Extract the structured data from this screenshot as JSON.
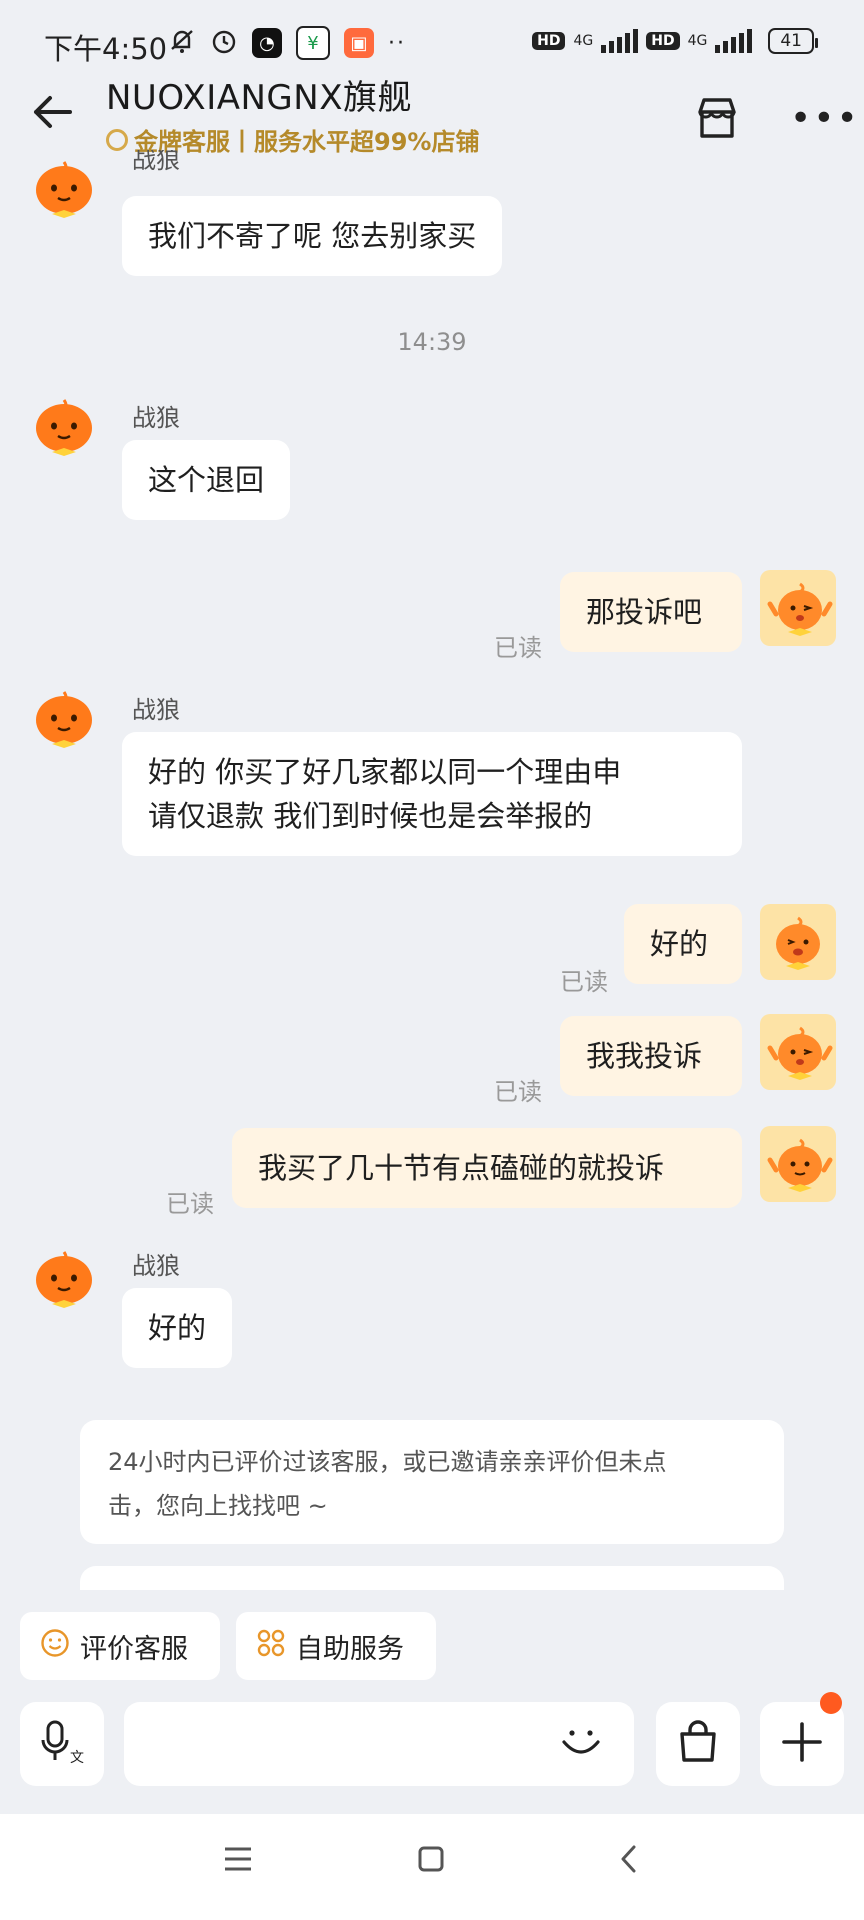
{
  "status_bar": {
    "time": "下午4:50",
    "network1": "HD",
    "network2": "HD",
    "signal_label": "4G",
    "battery": "41"
  },
  "header": {
    "shop_name": "NUOXIANGNX旗舰",
    "badge_text": "金牌客服丨服务水平超99%店铺"
  },
  "chat": {
    "agent_name": "战狼",
    "read_label": "已读",
    "timestamp": "14:39",
    "messages": {
      "m1": "我们不寄了呢 您去别家买",
      "m2": "这个退回",
      "m3": "那投诉吧",
      "m4_line1": "好的 你买了好几家都以同一个理由申",
      "m4_line2": "请仅退款 我们到时候也是会举报的",
      "m5": "好的",
      "m6": "我我投诉",
      "m7": "我买了几十节有点磕碰的就投诉",
      "m8": "好的"
    },
    "notice_line1": "24小时内已评价过该客服，或已邀请亲亲评价但未点",
    "notice_line2": "击，您向上找找吧 ~"
  },
  "quick_actions": {
    "rate_service": "评价客服",
    "self_service": "自助服务"
  },
  "input": {
    "placeholder": ""
  },
  "colors": {
    "accent_orange": "#ff7a1a",
    "gold": "#b58a2a",
    "right_bubble": "#fff4e3"
  }
}
